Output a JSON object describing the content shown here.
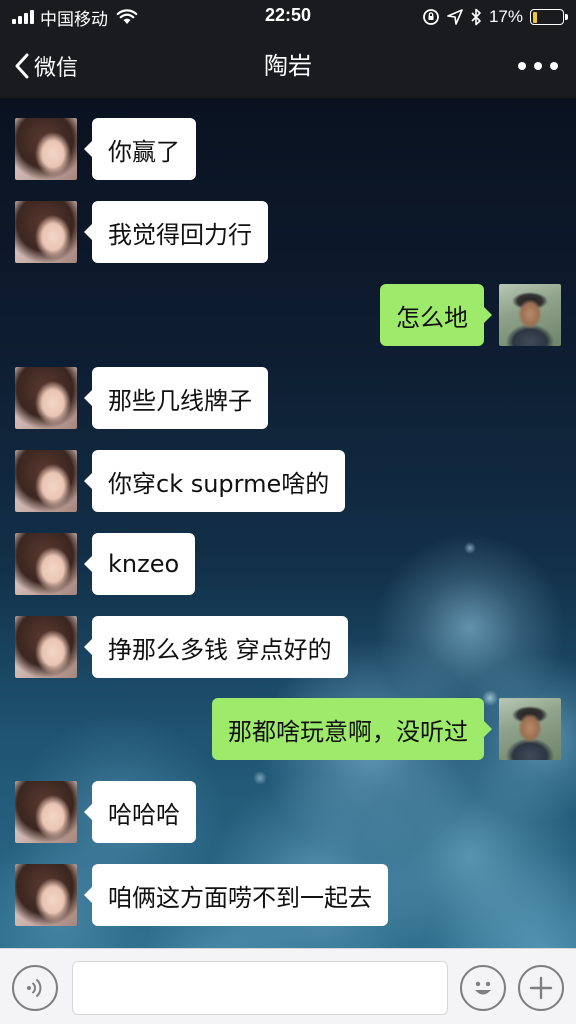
{
  "status_bar": {
    "carrier": "中国移动",
    "time": "22:50",
    "battery_percent": "17%",
    "battery_level": 0.17,
    "icons": [
      "signal-icon",
      "wifi-icon",
      "orientation-lock-icon",
      "location-icon",
      "bluetooth-icon",
      "battery-icon"
    ]
  },
  "nav": {
    "back_label": "微信",
    "title": "陶岩",
    "icons": [
      "back-chevron-icon",
      "more-icon"
    ]
  },
  "messages": [
    {
      "side": "left",
      "text": "你赢了"
    },
    {
      "side": "left",
      "text": "我觉得回力行"
    },
    {
      "side": "right",
      "text": "怎么地"
    },
    {
      "side": "left",
      "text": "那些几线牌子"
    },
    {
      "side": "left",
      "text": "你穿ck suprme啥的"
    },
    {
      "side": "left",
      "text": "knzeo"
    },
    {
      "side": "left",
      "text": "挣那么多钱 穿点好的"
    },
    {
      "side": "right",
      "text": "那都啥玩意啊，没听过"
    },
    {
      "side": "left",
      "text": "哈哈哈"
    },
    {
      "side": "left",
      "text": "咱俩这方面唠不到一起去"
    }
  ],
  "input_bar": {
    "text_value": "",
    "icons": [
      "voice-icon",
      "emoji-icon",
      "plus-icon"
    ]
  },
  "colors": {
    "nav_background": "#1a1b1e",
    "incoming_bubble": "#ffffff",
    "outgoing_bubble": "#9eea6a",
    "battery_fill": "#f5c630",
    "input_bar_background": "#f4f4f6"
  }
}
